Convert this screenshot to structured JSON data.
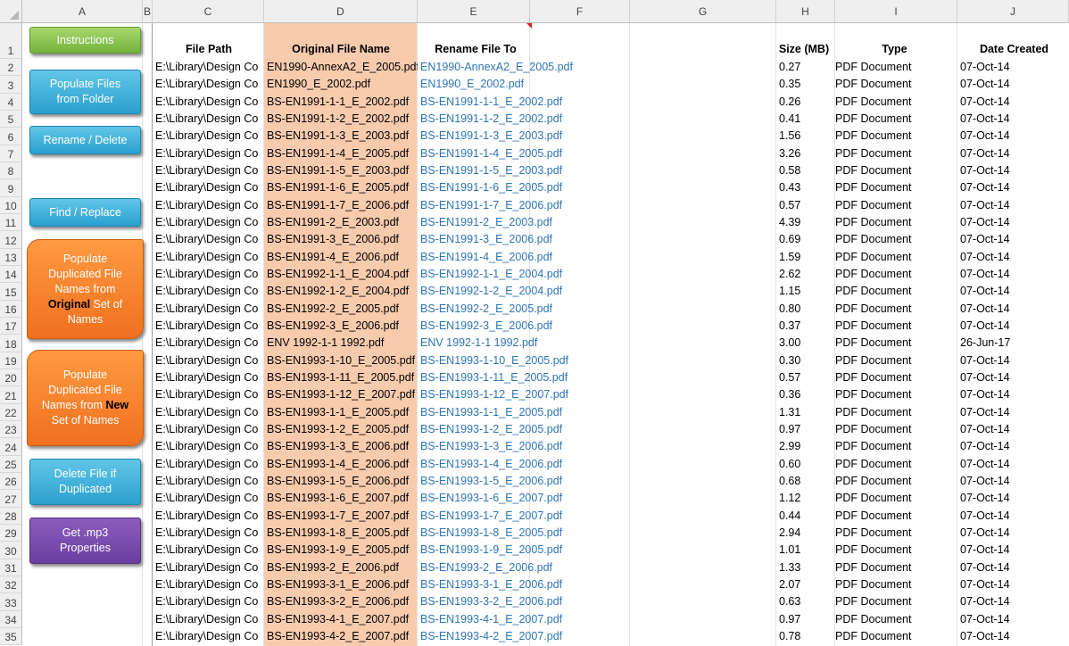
{
  "columns": [
    "A",
    "B",
    "C",
    "D",
    "E",
    "F",
    "G",
    "H",
    "I",
    "J"
  ],
  "headers": {
    "file_path": "File Path",
    "original": "Original File Name",
    "rename": "Rename File To",
    "size": "Size (MB)",
    "type": "Type",
    "date": "Date Created"
  },
  "buttons": {
    "instructions": "Instructions",
    "populate_files_1": "Populate Files",
    "populate_files_2": "from Folder",
    "rename_delete": "Rename / Delete",
    "find_replace": "Find / Replace",
    "dup_orig_1": "Populate",
    "dup_orig_2": "Duplicated File",
    "dup_orig_3": "Names from",
    "dup_orig_4a": "Original",
    "dup_orig_4b": " Set of",
    "dup_orig_5": "Names",
    "dup_new_1": "Populate",
    "dup_new_2": "Duplicated File",
    "dup_new_3a": "Names from ",
    "dup_new_3b": "New",
    "dup_new_4": "Set of Names",
    "delete_dup_1": "Delete File if",
    "delete_dup_2": "Duplicated",
    "mp3_1": "Get .mp3",
    "mp3_2": "Properties"
  },
  "rows": [
    {
      "path": "E:\\Library\\Design Co",
      "orig": "EN1990-AnnexA2_E_2005.pdf",
      "rename": "EN1990-AnnexA2_E_2005.pdf",
      "size": "0.27",
      "type": "PDF Document",
      "date": "07-Oct-14"
    },
    {
      "path": "E:\\Library\\Design Co",
      "orig": "EN1990_E_2002.pdf",
      "rename": "EN1990_E_2002.pdf",
      "size": "0.35",
      "type": "PDF Document",
      "date": "07-Oct-14"
    },
    {
      "path": "E:\\Library\\Design Co",
      "orig": "BS-EN1991-1-1_E_2002.pdf",
      "rename": "BS-EN1991-1-1_E_2002.pdf",
      "size": "0.26",
      "type": "PDF Document",
      "date": "07-Oct-14"
    },
    {
      "path": "E:\\Library\\Design Co",
      "orig": "BS-EN1991-1-2_E_2002.pdf",
      "rename": "BS-EN1991-1-2_E_2002.pdf",
      "size": "0.41",
      "type": "PDF Document",
      "date": "07-Oct-14"
    },
    {
      "path": "E:\\Library\\Design Co",
      "orig": "BS-EN1991-1-3_E_2003.pdf",
      "rename": "BS-EN1991-1-3_E_2003.pdf",
      "size": "1.56",
      "type": "PDF Document",
      "date": "07-Oct-14"
    },
    {
      "path": "E:\\Library\\Design Co",
      "orig": "BS-EN1991-1-4_E_2005.pdf",
      "rename": "BS-EN1991-1-4_E_2005.pdf",
      "size": "3.26",
      "type": "PDF Document",
      "date": "07-Oct-14"
    },
    {
      "path": "E:\\Library\\Design Co",
      "orig": "BS-EN1991-1-5_E_2003.pdf",
      "rename": "BS-EN1991-1-5_E_2003.pdf",
      "size": "0.58",
      "type": "PDF Document",
      "date": "07-Oct-14"
    },
    {
      "path": "E:\\Library\\Design Co",
      "orig": "BS-EN1991-1-6_E_2005.pdf",
      "rename": "BS-EN1991-1-6_E_2005.pdf",
      "size": "0.43",
      "type": "PDF Document",
      "date": "07-Oct-14"
    },
    {
      "path": "E:\\Library\\Design Co",
      "orig": "BS-EN1991-1-7_E_2006.pdf",
      "rename": "BS-EN1991-1-7_E_2006.pdf",
      "size": "0.57",
      "type": "PDF Document",
      "date": "07-Oct-14"
    },
    {
      "path": "E:\\Library\\Design Co",
      "orig": "BS-EN1991-2_E_2003.pdf",
      "rename": "BS-EN1991-2_E_2003.pdf",
      "size": "4.39",
      "type": "PDF Document",
      "date": "07-Oct-14"
    },
    {
      "path": "E:\\Library\\Design Co",
      "orig": "BS-EN1991-3_E_2006.pdf",
      "rename": "BS-EN1991-3_E_2006.pdf",
      "size": "0.69",
      "type": "PDF Document",
      "date": "07-Oct-14"
    },
    {
      "path": "E:\\Library\\Design Co",
      "orig": "BS-EN1991-4_E_2006.pdf",
      "rename": "BS-EN1991-4_E_2006.pdf",
      "size": "1.59",
      "type": "PDF Document",
      "date": "07-Oct-14"
    },
    {
      "path": "E:\\Library\\Design Co",
      "orig": "BS-EN1992-1-1_E_2004.pdf",
      "rename": "BS-EN1992-1-1_E_2004.pdf",
      "size": "2.62",
      "type": "PDF Document",
      "date": "07-Oct-14"
    },
    {
      "path": "E:\\Library\\Design Co",
      "orig": "BS-EN1992-1-2_E_2004.pdf",
      "rename": "BS-EN1992-1-2_E_2004.pdf",
      "size": "1.15",
      "type": "PDF Document",
      "date": "07-Oct-14"
    },
    {
      "path": "E:\\Library\\Design Co",
      "orig": "BS-EN1992-2_E_2005.pdf",
      "rename": "BS-EN1992-2_E_2005.pdf",
      "size": "0.80",
      "type": "PDF Document",
      "date": "07-Oct-14"
    },
    {
      "path": "E:\\Library\\Design Co",
      "orig": "BS-EN1992-3_E_2006.pdf",
      "rename": "BS-EN1992-3_E_2006.pdf",
      "size": "0.37",
      "type": "PDF Document",
      "date": "07-Oct-14"
    },
    {
      "path": "E:\\Library\\Design Co",
      "orig": "ENV 1992-1-1 1992.pdf",
      "rename": "ENV 1992-1-1 1992.pdf",
      "size": "3.00",
      "type": "PDF Document",
      "date": "26-Jun-17"
    },
    {
      "path": "E:\\Library\\Design Co",
      "orig": "BS-EN1993-1-10_E_2005.pdf",
      "rename": "BS-EN1993-1-10_E_2005.pdf",
      "size": "0.30",
      "type": "PDF Document",
      "date": "07-Oct-14"
    },
    {
      "path": "E:\\Library\\Design Co",
      "orig": "BS-EN1993-1-11_E_2005.pdf",
      "rename": "BS-EN1993-1-11_E_2005.pdf",
      "size": "0.57",
      "type": "PDF Document",
      "date": "07-Oct-14"
    },
    {
      "path": "E:\\Library\\Design Co",
      "orig": "BS-EN1993-1-12_E_2007.pdf",
      "rename": "BS-EN1993-1-12_E_2007.pdf",
      "size": "0.36",
      "type": "PDF Document",
      "date": "07-Oct-14"
    },
    {
      "path": "E:\\Library\\Design Co",
      "orig": "BS-EN1993-1-1_E_2005.pdf",
      "rename": "BS-EN1993-1-1_E_2005.pdf",
      "size": "1.31",
      "type": "PDF Document",
      "date": "07-Oct-14"
    },
    {
      "path": "E:\\Library\\Design Co",
      "orig": "BS-EN1993-1-2_E_2005.pdf",
      "rename": "BS-EN1993-1-2_E_2005.pdf",
      "size": "0.97",
      "type": "PDF Document",
      "date": "07-Oct-14"
    },
    {
      "path": "E:\\Library\\Design Co",
      "orig": "BS-EN1993-1-3_E_2006.pdf",
      "rename": "BS-EN1993-1-3_E_2006.pdf",
      "size": "2.99",
      "type": "PDF Document",
      "date": "07-Oct-14"
    },
    {
      "path": "E:\\Library\\Design Co",
      "orig": "BS-EN1993-1-4_E_2006.pdf",
      "rename": "BS-EN1993-1-4_E_2006.pdf",
      "size": "0.60",
      "type": "PDF Document",
      "date": "07-Oct-14"
    },
    {
      "path": "E:\\Library\\Design Co",
      "orig": "BS-EN1993-1-5_E_2006.pdf",
      "rename": "BS-EN1993-1-5_E_2006.pdf",
      "size": "0.68",
      "type": "PDF Document",
      "date": "07-Oct-14"
    },
    {
      "path": "E:\\Library\\Design Co",
      "orig": "BS-EN1993-1-6_E_2007.pdf",
      "rename": "BS-EN1993-1-6_E_2007.pdf",
      "size": "1.12",
      "type": "PDF Document",
      "date": "07-Oct-14"
    },
    {
      "path": "E:\\Library\\Design Co",
      "orig": "BS-EN1993-1-7_E_2007.pdf",
      "rename": "BS-EN1993-1-7_E_2007.pdf",
      "size": "0.44",
      "type": "PDF Document",
      "date": "07-Oct-14"
    },
    {
      "path": "E:\\Library\\Design Co",
      "orig": "BS-EN1993-1-8_E_2005.pdf",
      "rename": "BS-EN1993-1-8_E_2005.pdf",
      "size": "2.94",
      "type": "PDF Document",
      "date": "07-Oct-14"
    },
    {
      "path": "E:\\Library\\Design Co",
      "orig": "BS-EN1993-1-9_E_2005.pdf",
      "rename": "BS-EN1993-1-9_E_2005.pdf",
      "size": "1.01",
      "type": "PDF Document",
      "date": "07-Oct-14"
    },
    {
      "path": "E:\\Library\\Design Co",
      "orig": "BS-EN1993-2_E_2006.pdf",
      "rename": "BS-EN1993-2_E_2006.pdf",
      "size": "1.33",
      "type": "PDF Document",
      "date": "07-Oct-14"
    },
    {
      "path": "E:\\Library\\Design Co",
      "orig": "BS-EN1993-3-1_E_2006.pdf",
      "rename": "BS-EN1993-3-1_E_2006.pdf",
      "size": "2.07",
      "type": "PDF Document",
      "date": "07-Oct-14"
    },
    {
      "path": "E:\\Library\\Design Co",
      "orig": "BS-EN1993-3-2_E_2006.pdf",
      "rename": "BS-EN1993-3-2_E_2006.pdf",
      "size": "0.63",
      "type": "PDF Document",
      "date": "07-Oct-14"
    },
    {
      "path": "E:\\Library\\Design Co",
      "orig": "BS-EN1993-4-1_E_2007.pdf",
      "rename": "BS-EN1993-4-1_E_2007.pdf",
      "size": "0.97",
      "type": "PDF Document",
      "date": "07-Oct-14"
    },
    {
      "path": "E:\\Library\\Design Co",
      "orig": "BS-EN1993-4-2_E_2007.pdf",
      "rename": "BS-EN1993-4-2_E_2007.pdf",
      "size": "0.78",
      "type": "PDF Document",
      "date": "07-Oct-14"
    }
  ]
}
